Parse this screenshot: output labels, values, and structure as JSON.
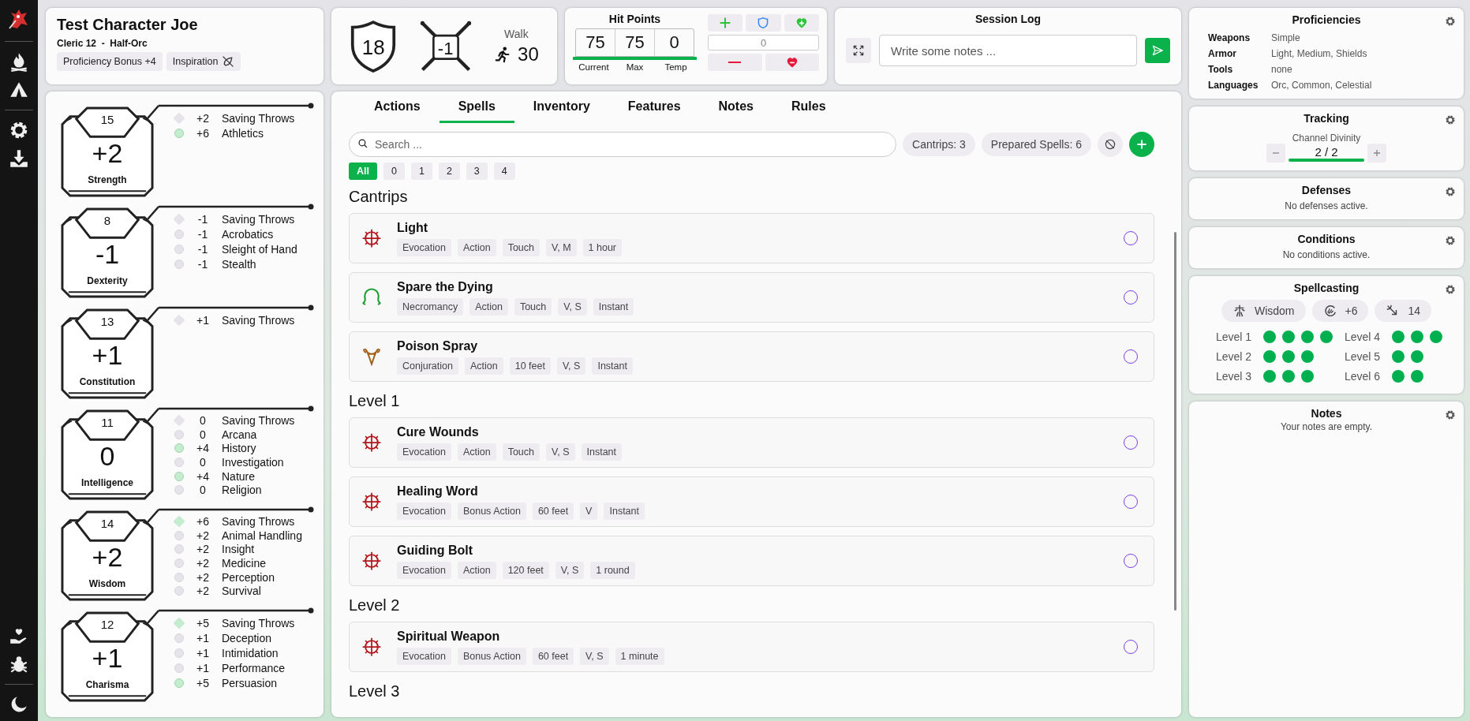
{
  "character": {
    "name": "Test Character Joe",
    "subtitle": "Cleric 12  -  Half-Orc",
    "proficiency_bonus": "Proficiency Bonus +4",
    "inspiration": {
      "label": "Inspiration",
      "on": false
    }
  },
  "combat": {
    "armor_class": "18",
    "initiative": "-1",
    "speed_label": "Walk",
    "speed": "30"
  },
  "hit_points": {
    "title": "Hit Points",
    "current": "75",
    "max": "75",
    "temp": "0",
    "level": 1,
    "labels": [
      "Current",
      "Max",
      "Temp"
    ],
    "amount_placeholder": "0"
  },
  "session_log": {
    "title": "Session Log",
    "placeholder": "Write some notes ..."
  },
  "abilities": [
    {
      "name": "Strength",
      "score": "15",
      "modifier": "+2",
      "skills": [
        {
          "kind": "save",
          "bonus": "+2",
          "name": "Saving Throws",
          "proficient": false
        },
        {
          "kind": "skill",
          "bonus": "+6",
          "name": "Athletics",
          "proficient": true
        }
      ]
    },
    {
      "name": "Dexterity",
      "score": "8",
      "modifier": "-1",
      "skills": [
        {
          "kind": "save",
          "bonus": "-1",
          "name": "Saving Throws",
          "proficient": false
        },
        {
          "kind": "skill",
          "bonus": "-1",
          "name": "Acrobatics",
          "proficient": false
        },
        {
          "kind": "skill",
          "bonus": "-1",
          "name": "Sleight of Hand",
          "proficient": false
        },
        {
          "kind": "skill",
          "bonus": "-1",
          "name": "Stealth",
          "proficient": false
        }
      ]
    },
    {
      "name": "Constitution",
      "score": "13",
      "modifier": "+1",
      "skills": [
        {
          "kind": "save",
          "bonus": "+1",
          "name": "Saving Throws",
          "proficient": false
        }
      ]
    },
    {
      "name": "Intelligence",
      "score": "11",
      "modifier": "0",
      "skills": [
        {
          "kind": "save",
          "bonus": "0",
          "name": "Saving Throws",
          "proficient": false
        },
        {
          "kind": "skill",
          "bonus": "0",
          "name": "Arcana",
          "proficient": false
        },
        {
          "kind": "skill",
          "bonus": "+4",
          "name": "History",
          "proficient": true
        },
        {
          "kind": "skill",
          "bonus": "0",
          "name": "Investigation",
          "proficient": false
        },
        {
          "kind": "skill",
          "bonus": "+4",
          "name": "Nature",
          "proficient": true
        },
        {
          "kind": "skill",
          "bonus": "0",
          "name": "Religion",
          "proficient": false
        }
      ]
    },
    {
      "name": "Wisdom",
      "score": "14",
      "modifier": "+2",
      "skills": [
        {
          "kind": "save",
          "bonus": "+6",
          "name": "Saving Throws",
          "proficient": true
        },
        {
          "kind": "skill",
          "bonus": "+2",
          "name": "Animal Handling",
          "proficient": false
        },
        {
          "kind": "skill",
          "bonus": "+2",
          "name": "Insight",
          "proficient": false
        },
        {
          "kind": "skill",
          "bonus": "+2",
          "name": "Medicine",
          "proficient": false
        },
        {
          "kind": "skill",
          "bonus": "+2",
          "name": "Perception",
          "proficient": false
        },
        {
          "kind": "skill",
          "bonus": "+2",
          "name": "Survival",
          "proficient": false
        }
      ]
    },
    {
      "name": "Charisma",
      "score": "12",
      "modifier": "+1",
      "skills": [
        {
          "kind": "save",
          "bonus": "+5",
          "name": "Saving Throws",
          "proficient": true
        },
        {
          "kind": "skill",
          "bonus": "+1",
          "name": "Deception",
          "proficient": false
        },
        {
          "kind": "skill",
          "bonus": "+1",
          "name": "Intimidation",
          "proficient": false
        },
        {
          "kind": "skill",
          "bonus": "+1",
          "name": "Performance",
          "proficient": false
        },
        {
          "kind": "skill",
          "bonus": "+5",
          "name": "Persuasion",
          "proficient": true
        }
      ]
    }
  ],
  "tabs": [
    {
      "label": "Actions",
      "selected": false
    },
    {
      "label": "Spells",
      "selected": true
    },
    {
      "label": "Inventory",
      "selected": false
    },
    {
      "label": "Features",
      "selected": false
    },
    {
      "label": "Notes",
      "selected": false
    },
    {
      "label": "Rules",
      "selected": false
    }
  ],
  "search": {
    "placeholder": "Search ..."
  },
  "counters": [
    "Cantrips: 3",
    "Prepared Spells: 6"
  ],
  "level_filters": [
    {
      "label": "All",
      "selected": true
    },
    {
      "label": "0",
      "selected": false
    },
    {
      "label": "1",
      "selected": false
    },
    {
      "label": "2",
      "selected": false
    },
    {
      "label": "3",
      "selected": false
    },
    {
      "label": "4",
      "selected": false
    }
  ],
  "spell_sections": [
    {
      "title": "Cantrips",
      "spells": [
        {
          "name": "Light",
          "kind": "evocation",
          "prepared": false,
          "tags": [
            "Evocation",
            "Action",
            "Touch",
            "V, M",
            "1 hour"
          ]
        },
        {
          "name": "Spare the Dying",
          "kind": "necromancy",
          "prepared": false,
          "tags": [
            "Necromancy",
            "Action",
            "Touch",
            "V, S",
            "Instant"
          ]
        },
        {
          "name": "Poison Spray",
          "kind": "conjuration",
          "prepared": false,
          "tags": [
            "Conjuration",
            "Action",
            "10 feet",
            "V, S",
            "Instant"
          ]
        }
      ]
    },
    {
      "title": "Level 1",
      "spells": [
        {
          "name": "Cure Wounds",
          "kind": "evocation",
          "prepared": false,
          "tags": [
            "Evocation",
            "Action",
            "Touch",
            "V, S",
            "Instant"
          ]
        },
        {
          "name": "Healing Word",
          "kind": "evocation",
          "prepared": false,
          "tags": [
            "Evocation",
            "Bonus Action",
            "60 feet",
            "V",
            "Instant"
          ]
        },
        {
          "name": "Guiding Bolt",
          "kind": "evocation",
          "prepared": false,
          "tags": [
            "Evocation",
            "Action",
            "120 feet",
            "V, S",
            "1 round"
          ]
        }
      ]
    },
    {
      "title": "Level 2",
      "spells": [
        {
          "name": "Spiritual Weapon",
          "kind": "evocation",
          "prepared": false,
          "tags": [
            "Evocation",
            "Bonus Action",
            "60 feet",
            "V, S",
            "1 minute"
          ]
        }
      ]
    },
    {
      "title": "Level 3"
    }
  ],
  "proficiencies": {
    "title": "Proficiencies",
    "rows": [
      {
        "label": "Weapons",
        "value": "Simple"
      },
      {
        "label": "Armor",
        "value": "Light, Medium, Shields"
      },
      {
        "label": "Tools",
        "value": "none"
      },
      {
        "label": "Languages",
        "value": "Orc, Common, Celestial"
      }
    ]
  },
  "tracking": {
    "title": "Tracking",
    "trackers": [
      {
        "name": "Channel Divinity",
        "value": "2 / 2",
        "level": 1
      }
    ]
  },
  "defenses": {
    "title": "Defenses",
    "text": "No defenses active."
  },
  "conditions": {
    "title": "Conditions",
    "text": "No conditions active."
  },
  "spellcasting": {
    "title": "Spellcasting",
    "stats": [
      {
        "kind": "ability",
        "value": "Wisdom"
      },
      {
        "kind": "attack",
        "value": "+6"
      },
      {
        "kind": "save_dc",
        "value": "14"
      }
    ],
    "slots": [
      {
        "label": "Level 1",
        "slots": [
          {
            "filled": true
          },
          {
            "filled": true
          },
          {
            "filled": true
          },
          {
            "filled": true
          }
        ]
      },
      {
        "label": "Level 2",
        "slots": [
          {
            "filled": true
          },
          {
            "filled": true
          },
          {
            "filled": true
          }
        ]
      },
      {
        "label": "Level 3",
        "slots": [
          {
            "filled": true
          },
          {
            "filled": true
          },
          {
            "filled": true
          }
        ]
      },
      {
        "label": "Level 4",
        "slots": [
          {
            "filled": true
          },
          {
            "filled": true
          },
          {
            "filled": true
          }
        ]
      },
      {
        "label": "Level 5",
        "slots": [
          {
            "filled": true
          },
          {
            "filled": true
          }
        ]
      },
      {
        "label": "Level 6",
        "slots": [
          {
            "filled": true
          },
          {
            "filled": true
          }
        ]
      }
    ]
  },
  "notes": {
    "title": "Notes",
    "text": "Your notes are empty."
  }
}
